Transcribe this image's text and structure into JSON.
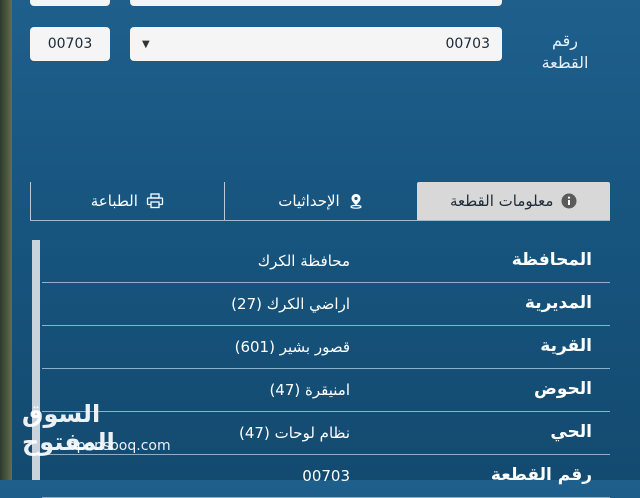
{
  "parcel": {
    "label_line1": "رقم",
    "label_line2": "القطعة",
    "small_value": "00703",
    "select_value": "00703"
  },
  "tabs": [
    {
      "label": "معلومات القطعة",
      "icon": "info-icon",
      "active": true
    },
    {
      "label": "الإحداثيات",
      "icon": "location-pin-icon",
      "active": false
    },
    {
      "label": "الطباعة",
      "icon": "printer-icon",
      "active": false
    }
  ],
  "info_rows": [
    {
      "key": "المحافظة",
      "value": "محافظة الكرك"
    },
    {
      "key": "المديرية",
      "value": "اراضي الكرك (27)"
    },
    {
      "key": "القرية",
      "value": "قصور بشير (601)"
    },
    {
      "key": "الحوض",
      "value": "امنيقرة (47)"
    },
    {
      "key": "الحي",
      "value": "نظام لوحات (47)"
    },
    {
      "key": "رقم القطعة",
      "value": "00703"
    }
  ],
  "watermark": {
    "arabic": "السوق المفتوح",
    "english": "opensooq.com"
  },
  "colors": {
    "background": "#17557f",
    "active_tab": "#d8d8d8",
    "input_bg": "#f5f5f5"
  }
}
